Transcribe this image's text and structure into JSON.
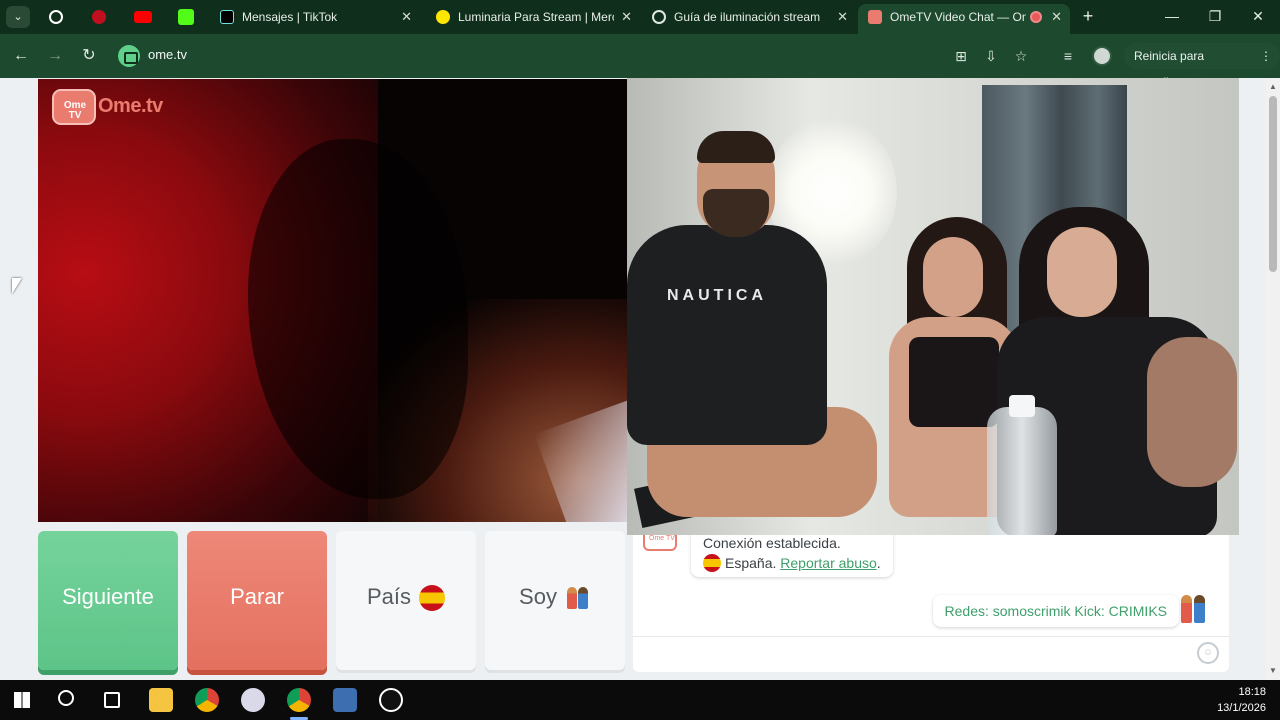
{
  "browser": {
    "tabs": [
      {
        "title": "Mensajes | TikTok",
        "favicon": "tiktok-icon"
      },
      {
        "title": "Luminaria Para Stream | Merc",
        "favicon": "mercadolibre-icon"
      },
      {
        "title": "Guía de iluminación stream",
        "favicon": "globe-icon"
      },
      {
        "title": "OmeTV Video Chat — On",
        "favicon": "ometv-icon"
      }
    ],
    "url": "ome.tv",
    "update_label": "Reinicia para actualizar",
    "update_more": "⋮",
    "new_tab": "+",
    "tab_close": "✕",
    "min": "—",
    "max": "❐",
    "close": "✕",
    "back": "←",
    "forward": "→",
    "reload": "↻",
    "menu_chevron": "⌄",
    "colors": {
      "chrome_dark": "#0f2e1c",
      "chrome_toolbar": "#1d4a2f",
      "accent_green": "#5dc488",
      "accent_red": "#e4705f"
    }
  },
  "ometv": {
    "logo_tv": "Ome TV",
    "logo_word": "Ome.tv",
    "buttons": {
      "next": "Siguiente",
      "stop": "Parar",
      "country": "País",
      "gender": "Soy"
    },
    "chat": {
      "bot_label": "Ome TV",
      "connection": "Conexión establecida.",
      "country_name": "España.",
      "report": "Reportar abuso",
      "report_dot": ".",
      "outgoing": "Redes: somoscrimik Kick: CRIMIKS",
      "input_placeholder": ""
    },
    "video_right_shirt": "NAUTICA"
  },
  "taskbar": {
    "time": "18:18",
    "date": "13/1/2026"
  }
}
